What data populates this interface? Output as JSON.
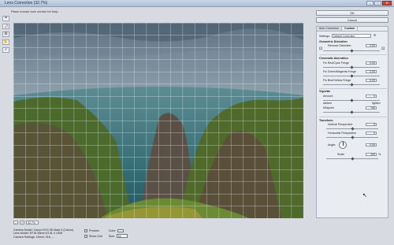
{
  "window": {
    "title": "Lens Correction (32.7%)",
    "min": "–",
    "max": "□",
    "close": "✕"
  },
  "hint": "Place mouse over control for help.",
  "tools": [
    "remove-distortion-tool",
    "straighten-tool",
    "move-grid-tool",
    "hand-tool",
    "zoom-tool"
  ],
  "tool_glyphs": [
    "⌗",
    "◿",
    "⊞",
    "✋",
    "⌕"
  ],
  "actions": {
    "ok": "OK",
    "cancel": "Cancel"
  },
  "tabs": [
    {
      "label": "Auto Correction"
    },
    {
      "label": "Custom"
    }
  ],
  "settings": {
    "label": "Settings:",
    "value": "Default Correction"
  },
  "geometric": {
    "heading": "Geometric Distortion",
    "remove_label": "Remove Distortion",
    "remove_value": "0.00"
  },
  "chromatic": {
    "heading": "Chromatic Aberration",
    "red_cyan_label": "Fix Red/Cyan Fringe",
    "red_cyan_value": "0.00",
    "green_magenta_label": "Fix Green/Magenta Fringe",
    "green_magenta_value": "0.00",
    "blue_yellow_label": "Fix Blue/Yellow Fringe",
    "blue_yellow_value": "0.00"
  },
  "vignette": {
    "heading": "Vignette",
    "amount_label": "Amount",
    "amount_value": "0",
    "darken": "darken",
    "lighten": "lighten",
    "midpoint_label": "Midpoint",
    "midpoint_value": "+50"
  },
  "transform": {
    "heading": "Transform",
    "vertical_label": "Vertical Perspective",
    "vertical_value": "0",
    "horizontal_label": "Horizontal Perspective",
    "horizontal_value": "0",
    "angle_label": "Angle:",
    "angle_value": "0.00",
    "scale_label": "Scale",
    "scale_value": "100",
    "scale_unit": "%"
  },
  "zoom": {
    "minus": "–",
    "plus": "+",
    "value": "32.7%"
  },
  "camera": {
    "model": "Camera Model: Canon EOS 5D Mark II (Canon)",
    "lens": "Lens Model: EF16-35mm f/2.8L II USM",
    "settings": "Camera Settings: 16mm, f/16, –"
  },
  "options": {
    "preview_label": "Preview",
    "show_grid_label": "Show Grid",
    "color_label": "Color:",
    "size_label": "Size:",
    "size_value": "64"
  },
  "colors": {
    "accent": "#3c6fb4",
    "panel": "#e9ecf0",
    "sky": "#5f7788",
    "sea": "#2f6b73",
    "grass": "#4e6a2e",
    "rock": "#5a4a3e"
  }
}
